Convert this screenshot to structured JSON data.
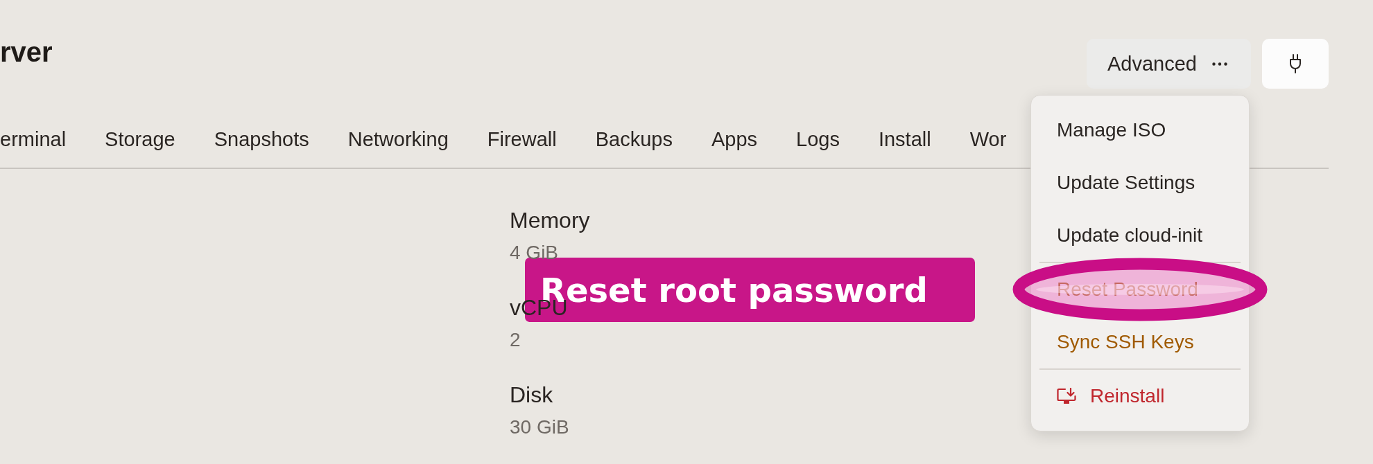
{
  "page_title": "rver",
  "toolbar": {
    "advanced_button": {
      "label": "Advanced"
    }
  },
  "tabs": [
    {
      "label": "erminal",
      "selected": false
    },
    {
      "label": "Storage",
      "selected": false
    },
    {
      "label": "Snapshots",
      "selected": false
    },
    {
      "label": "Networking",
      "selected": false
    },
    {
      "label": "Firewall",
      "selected": false
    },
    {
      "label": "Backups",
      "selected": false
    },
    {
      "label": "Apps",
      "selected": false
    },
    {
      "label": "Logs",
      "selected": false
    },
    {
      "label": "Install",
      "selected": false
    },
    {
      "label": "Wor",
      "selected": false
    }
  ],
  "specs": [
    {
      "label": "Memory",
      "value": "4 GiB"
    },
    {
      "label": "vCPU",
      "value": "2"
    },
    {
      "label": "Disk",
      "value": "30 GiB"
    }
  ],
  "dropdown_menu": {
    "groups": [
      {
        "items": [
          {
            "label": "Manage ISO",
            "kind": "normal",
            "highlighted": false
          },
          {
            "label": "Update Settings",
            "kind": "normal",
            "highlighted": false
          },
          {
            "label": "Update cloud-init",
            "kind": "normal",
            "highlighted": false
          }
        ]
      },
      {
        "items": [
          {
            "label": "Reset Password",
            "kind": "warning",
            "highlighted": true
          },
          {
            "label": "Sync SSH Keys",
            "kind": "warning",
            "highlighted": false
          }
        ]
      },
      {
        "items": [
          {
            "label": "Reinstall",
            "kind": "danger",
            "highlighted": false
          }
        ]
      }
    ]
  },
  "callout": {
    "text": "Reset root password"
  }
}
